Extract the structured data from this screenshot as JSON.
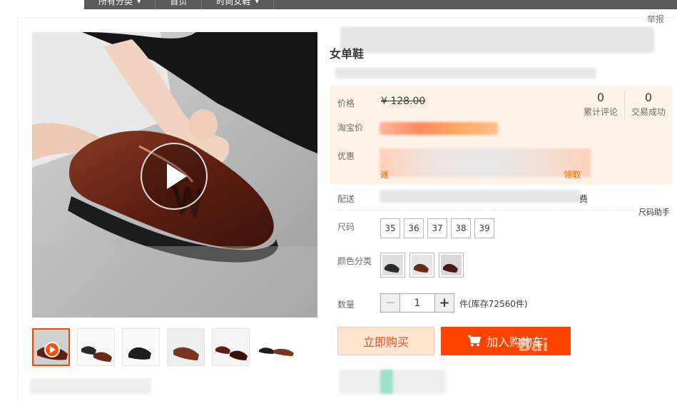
{
  "topnav": {
    "items": [
      {
        "label": "所有分类",
        "has_caret": true
      },
      {
        "label": "首页",
        "has_caret": false
      },
      {
        "label": "时尚女鞋",
        "has_caret": true
      }
    ],
    "caret": "▼"
  },
  "report_label": "举报",
  "product": {
    "title_visible": "女单鞋"
  },
  "price_panel": {
    "price_label": "价格",
    "original_price": "¥ 128.00",
    "taobao_price_label": "淘宝价",
    "promo_label": "优惠",
    "promo_link_left": "返",
    "promo_link_right": "领取",
    "shipping_label": "配送",
    "shipping_tail": "费",
    "stats": [
      {
        "value": "0",
        "label": "累计评论"
      },
      {
        "value": "0",
        "label": "交易成功"
      }
    ]
  },
  "size_helper": "尺码助手",
  "sizes": {
    "label": "尺码",
    "options": [
      "35",
      "36",
      "37",
      "38",
      "39"
    ]
  },
  "colors": {
    "label": "颜色分类",
    "count": 3
  },
  "quantity": {
    "label": "数量",
    "value": "1",
    "minus": "−",
    "plus": "+",
    "stock_text": "件(库存72560件)"
  },
  "actions": {
    "buy_now": "立即购买",
    "add_to_cart": "加入购物车",
    "cart_icon": "cart-icon"
  },
  "watermark": "Bai"
}
